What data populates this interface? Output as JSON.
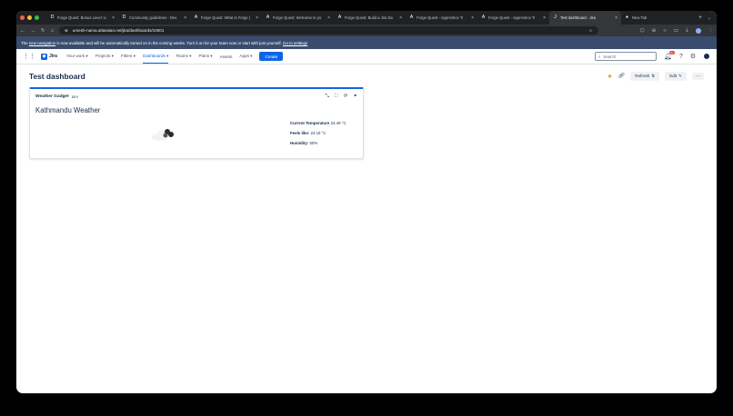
{
  "browser": {
    "tabs": [
      {
        "title": "Forge Quest: Bonus Level: Li",
        "fav": "D"
      },
      {
        "title": "Community guidelines - Dev",
        "fav": "D"
      },
      {
        "title": "Forge Quest: What is Forge |",
        "fav": "A"
      },
      {
        "title": "Forge Quest: Welcome to yo",
        "fav": "A"
      },
      {
        "title": "Forge Quest: Build a Jira Da",
        "fav": "A"
      },
      {
        "title": "Forge Quest - Apprentice Ti",
        "fav": "A"
      },
      {
        "title": "Forge Quest - Apprentice Ti",
        "fav": "A"
      },
      {
        "title": "Test dashboard - Jira",
        "fav": "J",
        "active": true
      },
      {
        "title": "New Tab",
        "fav": "●"
      }
    ],
    "url": "umesh-narva.atlassian.net/jira/dashboards/10001"
  },
  "banner": {
    "prefix": "The",
    "link1": "new navigation",
    "middle": "is now available and will be automatically turned on in the coming weeks. Turn it on for your team now or start with just yourself.",
    "link2": "Go to settings"
  },
  "nav": {
    "product": "Jira",
    "items": [
      "Your work ▾",
      "Projects ▾",
      "Filters ▾",
      "Dashboards ▾",
      "Teams ▾",
      "Plans ▾",
      "Assets",
      "Apps ▾"
    ],
    "active_index": 3,
    "create": "Create",
    "search_placeholder": "Search",
    "notif_count": "9+"
  },
  "page": {
    "title": "Test dashboard",
    "refresh": "Refresh",
    "edit": "Edit"
  },
  "gadget": {
    "title": "Weather Gadget",
    "badge": "DEV",
    "city": "Kathmandu Weather",
    "stats": [
      {
        "label": "Current Temperature",
        "value": "23.49 °C"
      },
      {
        "label": "Feels like:",
        "value": "23.19 °C"
      },
      {
        "label": "Humidity:",
        "value": "50%"
      }
    ]
  },
  "colors": {
    "brand": "#0c66e4",
    "banner": "#3a4c6e"
  }
}
